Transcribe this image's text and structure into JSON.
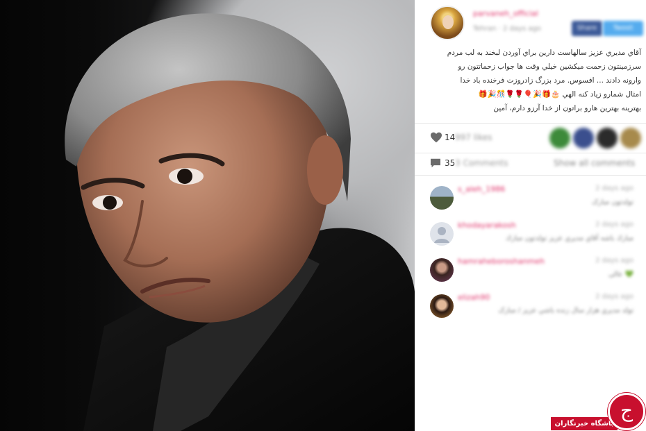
{
  "post": {
    "username": "parvaneh_official",
    "subline": "Tehran · 2 days ago",
    "share_facebook": "Share",
    "share_twitter": "Tweet",
    "caption": [
      "آقاي مديري عزيز سالهاست دارين براي آوردن لبخند به لب مردم",
      "سرزمينتون زحمت ميكشين خيلي وقت ها جواب زحماتتون رو",
      "وارونه دادند ... افسوس. مرد بزرگ زادروزت فرخنده باد خدا",
      "امثال شمارو زياد كنه الهي 🎂🎁🎉🎈🌹🌹🎊🎉🎁",
      "بهترينه بهترين هارو براتون از خدا آرزو دارم، آمين"
    ],
    "likes_count": "14",
    "likes_word": "997 likes",
    "comments_count": "35",
    "comments_word": "3 Comments",
    "show_all": "Show all comments"
  },
  "comments": [
    {
      "user": "s_aleh_1986",
      "time": "2 days ago",
      "text": "تولدتون مبارک"
    },
    {
      "user": "khodayarakosh",
      "time": "2 days ago",
      "text": "مبارك باشه آقاي مديري عزيز تولدتون مبارك"
    },
    {
      "user": "hamraheboroshanmeh",
      "time": "2 days ago",
      "text": "💚 عالی"
    },
    {
      "user": "elizah90",
      "time": "2 days ago",
      "text": "تولد مديري هزار سال زنده باشي عزيز / مبارک"
    }
  ],
  "watermark": {
    "logo_glyph": "ج",
    "label": "باشگاه خبرنگاران"
  },
  "colors": {
    "username": "#e0336a",
    "brand_red": "#c8102e",
    "facebook": "#3b5998",
    "twitter": "#55acee"
  }
}
